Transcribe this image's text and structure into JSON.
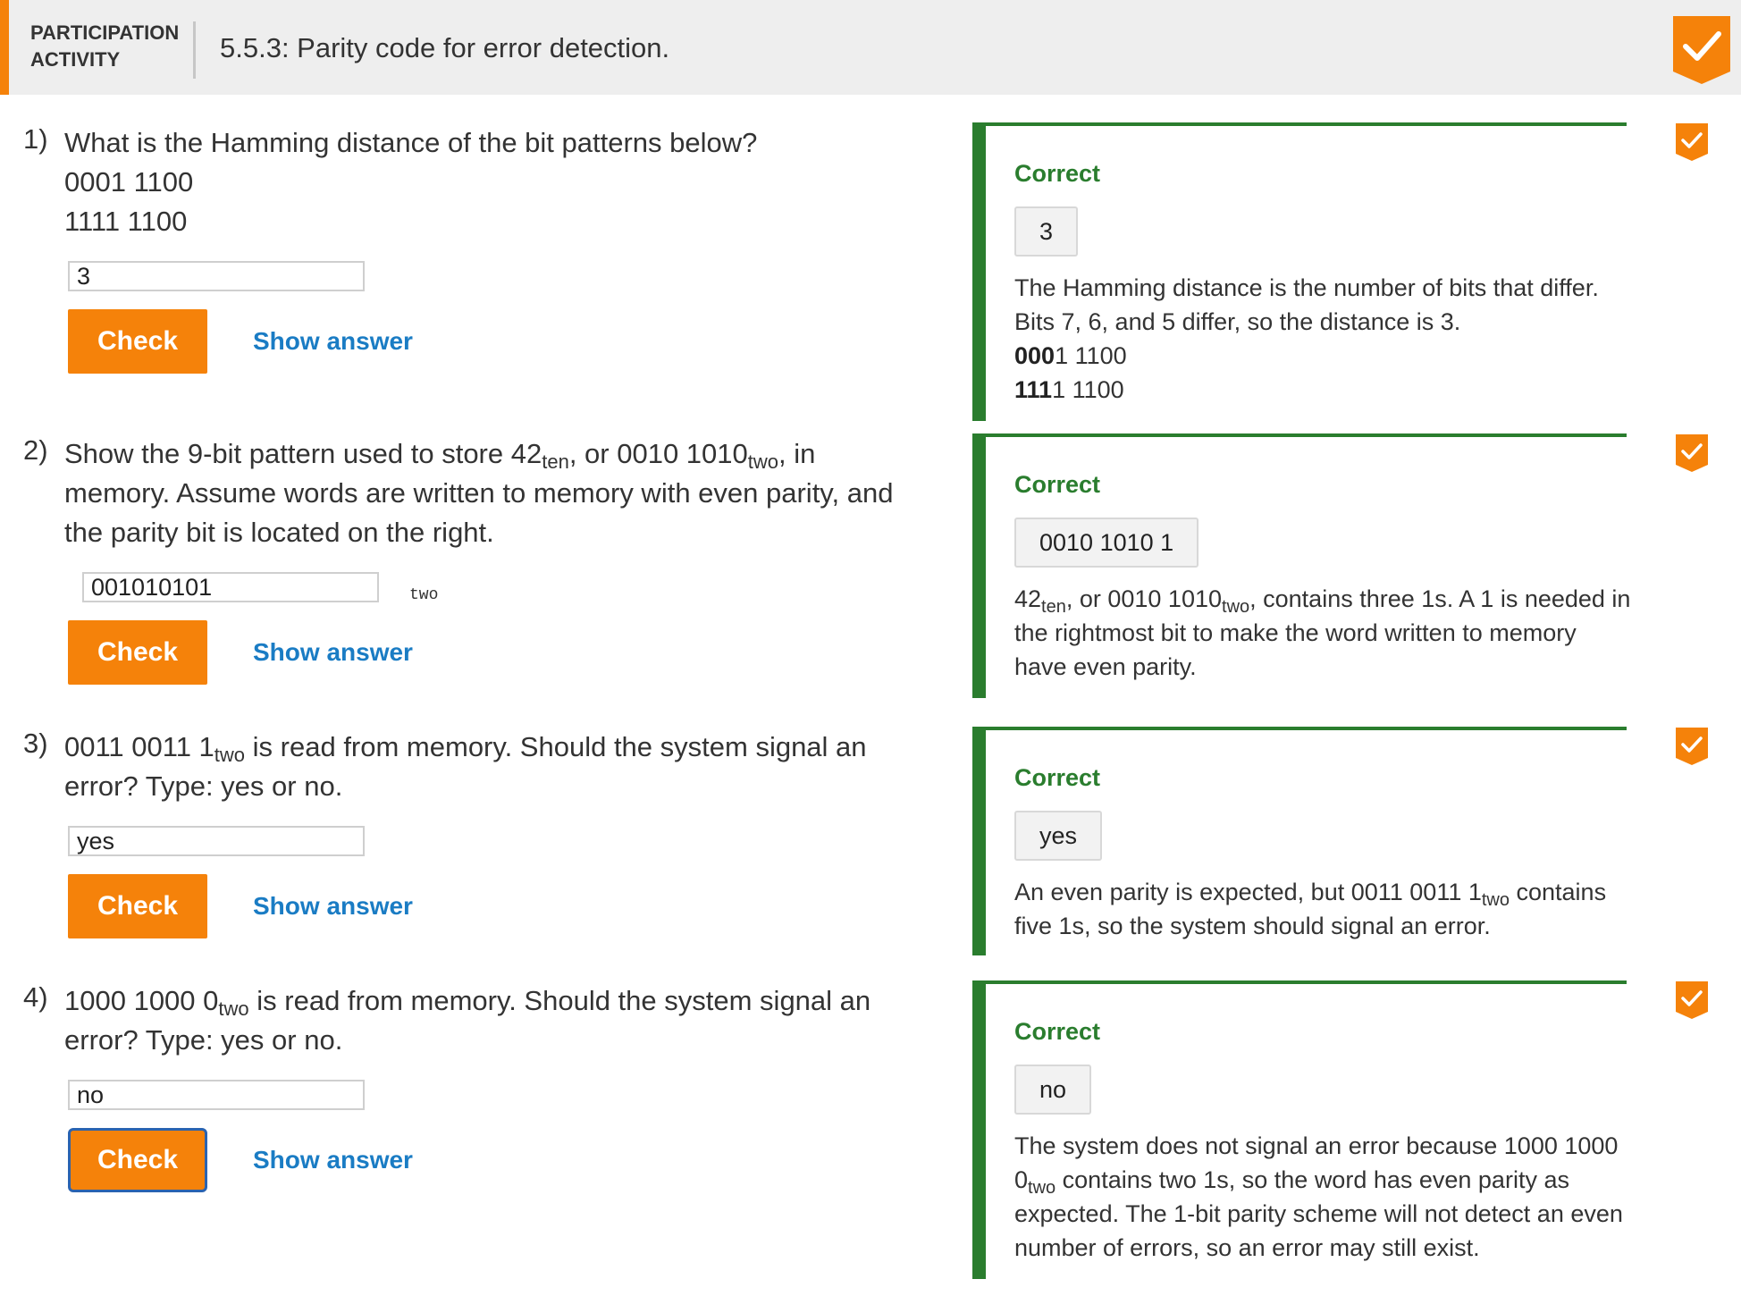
{
  "header": {
    "label_line1": "PARTICIPATION",
    "label_line2": "ACTIVITY",
    "title": "5.5.3: Parity code for error detection."
  },
  "colors": {
    "accent": "#f5820a",
    "correct": "#2a7d2e",
    "link": "#1a7cc4",
    "focus": "#2a63b0"
  },
  "buttons": {
    "check_label": "Check",
    "show_answer_label": "Show answer"
  },
  "questions": [
    {
      "number": "1)",
      "text_line1": "What is the Hamming distance of the bit patterns below?",
      "text_line2": "0001 1100",
      "text_line3": "1111 1100",
      "input_value": "3",
      "feedback_status": "Correct",
      "feedback_answer": "3",
      "explanation_line1": "The Hamming distance is the number of bits that differ.",
      "explanation_line2": "Bits 7, 6, and 5 differ, so the distance is 3.",
      "pattern1_bold": "000",
      "pattern1_rest": "1 1100",
      "pattern2_bold": "111",
      "pattern2_rest": "1 1100"
    },
    {
      "number": "2)",
      "text_a": "Show the 9-bit pattern used to store 42",
      "text_sub1": "ten",
      "text_b": ", or 0010 1010",
      "text_sub2": "two",
      "text_c": ", in memory. Assume words are written to memory with even parity, and the parity bit is located on the right.",
      "input_value": "001010101",
      "input_unit": "two",
      "feedback_status": "Correct",
      "feedback_answer": "0010 1010 1",
      "explanation_a": "42",
      "explanation_sub1": "ten",
      "explanation_b": ", or 0010 1010",
      "explanation_sub2": "two",
      "explanation_c": ", contains three 1s. A 1 is needed in the rightmost bit to make the word written to memory have even parity."
    },
    {
      "number": "3)",
      "text_a": "0011 0011 1",
      "text_sub": "two",
      "text_b": " is read from memory. Should the system signal an error? Type: yes or no.",
      "input_value": "yes",
      "feedback_status": "Correct",
      "feedback_answer": "yes",
      "explanation_a": "An even parity is expected, but 0011 0011 1",
      "explanation_sub": "two",
      "explanation_b": " contains five 1s, so the system should signal an error."
    },
    {
      "number": "4)",
      "text_a": "1000 1000 0",
      "text_sub": "two",
      "text_b": " is read from memory. Should the system signal an error? Type: yes or no.",
      "input_value": "no",
      "feedback_status": "Correct",
      "feedback_answer": "no",
      "explanation_a": "The system does not signal an error because 1000 1000 0",
      "explanation_sub": "two",
      "explanation_b": " contains two 1s, so the word has even parity as expected. The 1-bit parity scheme will not detect an even number of errors, so an error may still exist."
    }
  ]
}
